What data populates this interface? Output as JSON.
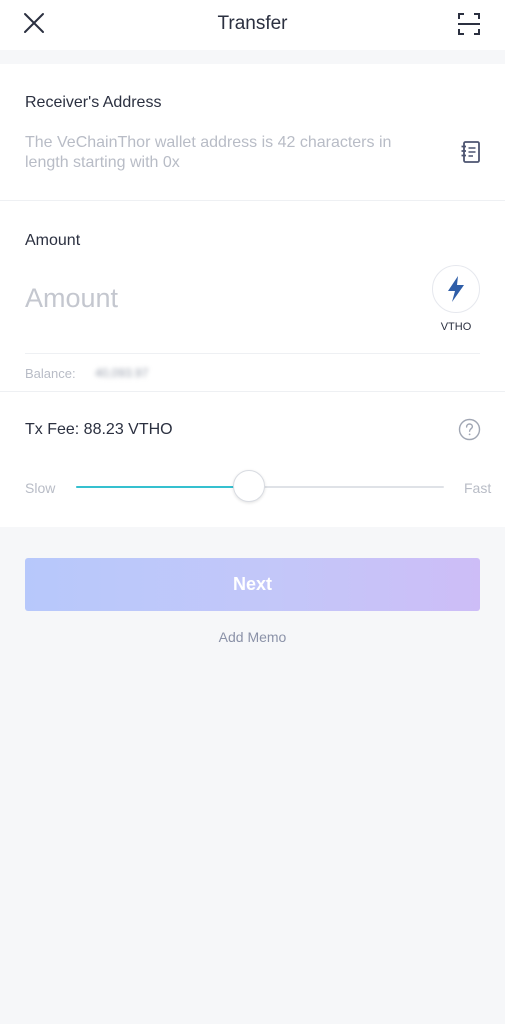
{
  "header": {
    "title": "Transfer",
    "close_icon": "close-icon",
    "scan_icon": "scan-qr-icon"
  },
  "receiver": {
    "label": "Receiver's Address",
    "placeholder": "The VeChainThor wallet address is 42 characters in length starting with 0x",
    "address_book_icon": "address-book-icon"
  },
  "amount": {
    "label": "Amount",
    "placeholder": "Amount",
    "token_symbol": "VTHO",
    "token_icon": "lightning-icon",
    "balance_label": "Balance:",
    "balance_value": "40,093.97"
  },
  "fee": {
    "label": "Tx Fee: 88.23 VTHO",
    "help_icon": "help-icon",
    "slow_label": "Slow",
    "fast_label": "Fast",
    "slider_level": 0.47
  },
  "actions": {
    "next_label": "Next",
    "memo_label": "Add Memo"
  },
  "colors": {
    "accent": "#35c0cf",
    "button_gradient_start": "#b7c8fb",
    "button_gradient_end": "#cdbdf7",
    "token_icon": "#2f5ea8"
  }
}
